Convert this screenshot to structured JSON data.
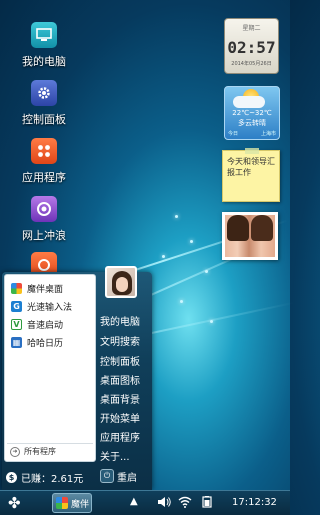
{
  "desktop": {
    "icons": [
      {
        "label": "我的电脑",
        "icon": "computer-icon"
      },
      {
        "label": "控制面板",
        "icon": "gear-icon"
      },
      {
        "label": "应用程序",
        "icon": "apps-icon"
      },
      {
        "label": "网上冲浪",
        "icon": "browser-icon"
      }
    ]
  },
  "widgets": {
    "clock": {
      "day": "星期二",
      "time": "02:57",
      "date": "2014年05月26日"
    },
    "weather": {
      "temp": "22℃~32℃",
      "desc": "多云转晴",
      "today": "今日",
      "city": "上海市"
    },
    "note": {
      "text": "今天和领导汇报工作"
    }
  },
  "start_menu": {
    "programs": [
      {
        "label": "魔伴桌面",
        "icon": "moban-icon",
        "color": "#e8573e"
      },
      {
        "label": "光速输入法",
        "icon": "input-method-icon",
        "color": "#1c7fd1"
      },
      {
        "label": "音速启动",
        "icon": "launcher-icon",
        "color": "#2e9a3e"
      },
      {
        "label": "哈哈日历",
        "icon": "calendar-icon",
        "color": "#2a6fc2"
      }
    ],
    "all_programs": "所有程序",
    "right_items": [
      "我的电脑",
      "文明搜索",
      "控制面板",
      "桌面图标",
      "桌面背景",
      "开始菜单",
      "应用程序",
      "关于..."
    ],
    "earnings": "已赚：2.61元",
    "restart": "重启"
  },
  "taskbar": {
    "start_icon": "clover-icon",
    "app_label": "魔伴",
    "time": "17:12:32",
    "tray_icons": [
      "show-hidden-arrow-icon",
      "volume-icon",
      "wifi-icon",
      "battery-icon"
    ]
  },
  "colors": {
    "accent": "#1d9fc4",
    "taskbar": "#0a2b40"
  }
}
